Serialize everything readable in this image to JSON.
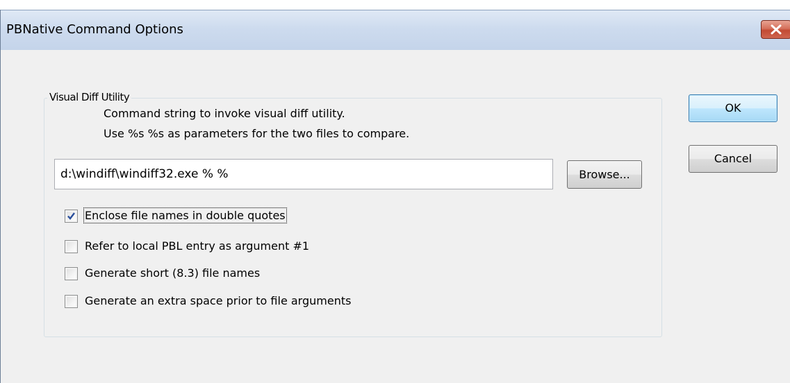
{
  "window": {
    "title": "PBNative Command Options",
    "close_icon": "close-x-icon"
  },
  "group": {
    "label": "Visual Diff Utility",
    "description_line1": "Command  string to invoke visual diff utility.",
    "description_line2": "Use %s %s as parameters for the two files to compare."
  },
  "command": {
    "value": "d:\\windiff\\windiff32.exe % %",
    "placeholder": ""
  },
  "buttons": {
    "browse": "Browse...",
    "ok": "OK",
    "cancel": "Cancel"
  },
  "options": [
    {
      "label": "Enclose file names in double quotes",
      "checked": true
    },
    {
      "label": "Refer to local PBL entry as argument #1",
      "checked": false
    },
    {
      "label": "Generate short (8.3) file names",
      "checked": false
    },
    {
      "label": "Generate an extra space prior to file arguments",
      "checked": false
    }
  ],
  "colors": {
    "checkmark": "#2a4f9c",
    "close_button": "#c24a33",
    "default_button_border": "#3c7fb1"
  }
}
